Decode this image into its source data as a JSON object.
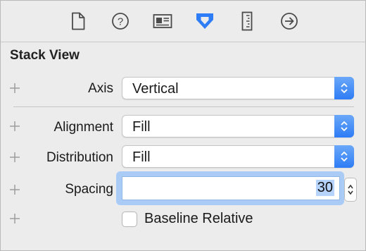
{
  "toolbar": {
    "tabs": [
      {
        "icon": "file-inspector-icon",
        "active": false
      },
      {
        "icon": "quick-help-icon",
        "active": false
      },
      {
        "icon": "identity-inspector-icon",
        "active": false
      },
      {
        "icon": "attributes-inspector-icon",
        "active": true
      },
      {
        "icon": "size-inspector-icon",
        "active": false
      },
      {
        "icon": "connections-inspector-icon",
        "active": false
      }
    ]
  },
  "section": {
    "title": "Stack View"
  },
  "fields": {
    "axis": {
      "label": "Axis",
      "value": "Vertical"
    },
    "alignment": {
      "label": "Alignment",
      "value": "Fill"
    },
    "distribution": {
      "label": "Distribution",
      "value": "Fill"
    },
    "spacing": {
      "label": "Spacing",
      "value": "30"
    },
    "baseline_relative": {
      "label": "Baseline Relative",
      "checked": false
    }
  },
  "colors": {
    "accent": "#2e7cf6",
    "focus_ring": "#a9cbf6",
    "selection": "#b5d3fb",
    "background": "#ececec"
  }
}
